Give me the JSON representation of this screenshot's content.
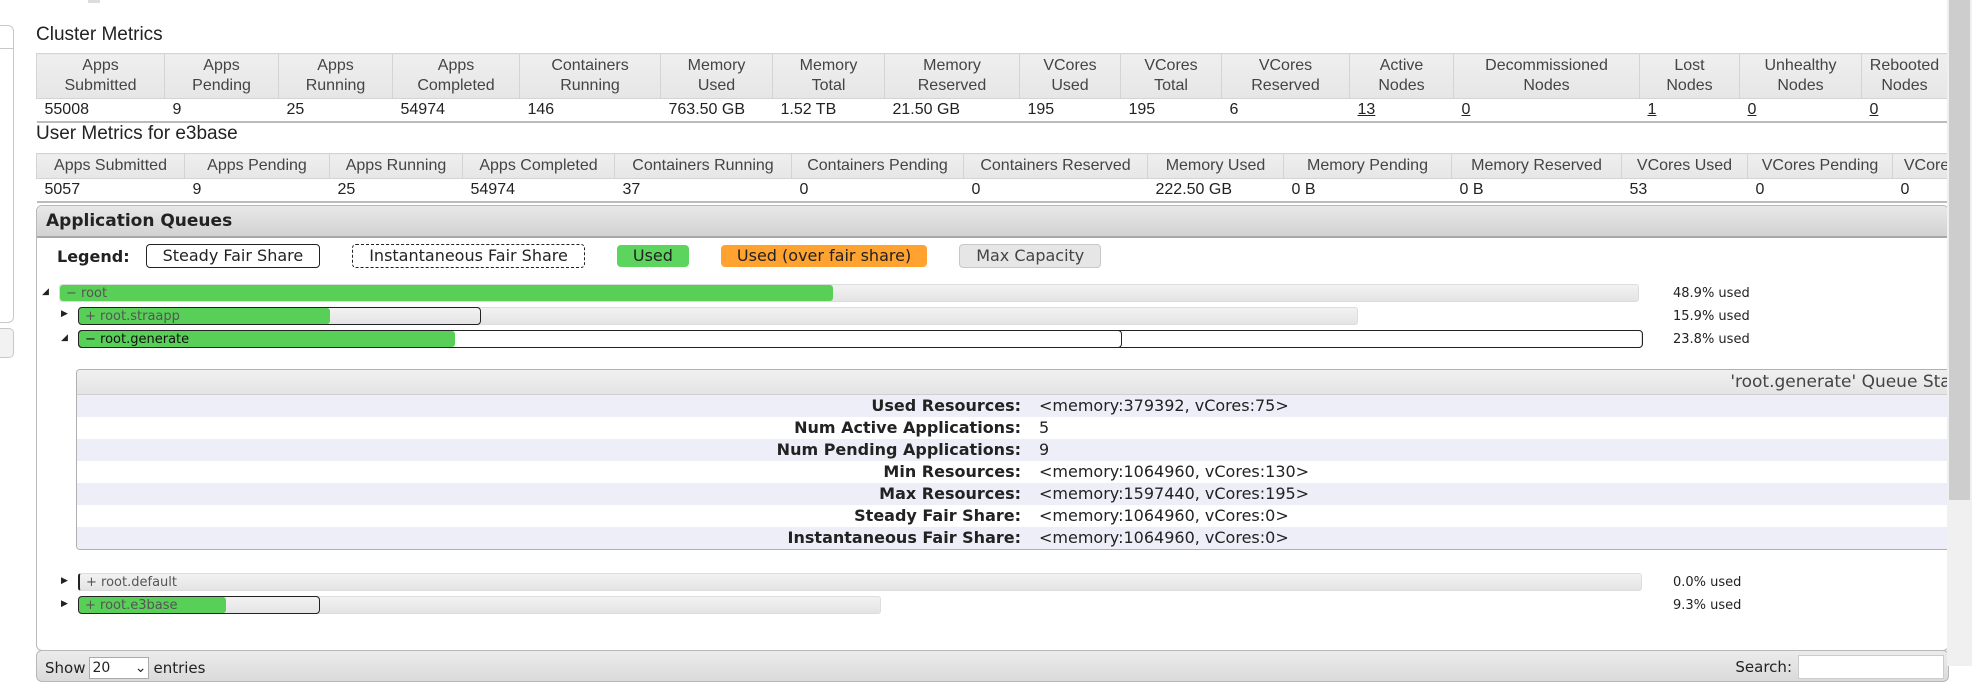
{
  "cluster_metrics": {
    "title": "Cluster Metrics",
    "headers": [
      [
        "Apps",
        "Submitted"
      ],
      [
        "Apps",
        "Pending"
      ],
      [
        "Apps",
        "Running"
      ],
      [
        "Apps",
        "Completed"
      ],
      [
        "Containers",
        "Running"
      ],
      [
        "Memory",
        "Used"
      ],
      [
        "Memory",
        "Total"
      ],
      [
        "Memory",
        "Reserved"
      ],
      [
        "VCores",
        "Used"
      ],
      [
        "VCores",
        "Total"
      ],
      [
        "VCores",
        "Reserved"
      ],
      [
        "Active",
        "Nodes"
      ],
      [
        "Decommissioned",
        "Nodes"
      ],
      [
        "Lost",
        "Nodes"
      ],
      [
        "Unhealthy",
        "Nodes"
      ],
      [
        "Rebooted",
        "Nodes"
      ]
    ],
    "values": [
      "55008",
      "9",
      "25",
      "54974",
      "146",
      "763.50 GB",
      "1.52 TB",
      "21.50 GB",
      "195",
      "195",
      "6",
      "13",
      "0",
      "1",
      "0",
      "0"
    ],
    "linked": [
      false,
      false,
      false,
      false,
      false,
      false,
      false,
      false,
      false,
      false,
      false,
      true,
      true,
      true,
      true,
      true
    ]
  },
  "user_metrics": {
    "title": "User Metrics for e3base",
    "headers": [
      "Apps Submitted",
      "Apps Pending",
      "Apps Running",
      "Apps Completed",
      "Containers Running",
      "Containers Pending",
      "Containers Reserved",
      "Memory Used",
      "Memory Pending",
      "Memory Reserved",
      "VCores Used",
      "VCores Pending",
      "VCores Reserved"
    ],
    "values": [
      "5057",
      "9",
      "25",
      "54974",
      "37",
      "0",
      "0",
      "222.50 GB",
      "0 B",
      "0 B",
      "53",
      "0",
      "0"
    ]
  },
  "queues": {
    "title": "Application Queues",
    "legend": {
      "label": "Legend:",
      "items": [
        "Steady Fair Share",
        "Instantaneous Fair Share",
        "Used",
        "Used (over fair share)",
        "Max Capacity"
      ]
    },
    "colors": {
      "used": "#58d058",
      "over": "#ffa230",
      "max": "#e6e6e6"
    },
    "list": [
      {
        "name": "root",
        "sign": "−",
        "expanded": true,
        "used_pct": "48.9% used",
        "used_fraction": 0.489
      },
      {
        "name": "root.straapp",
        "sign": "+",
        "expanded": false,
        "used_pct": "15.9% used",
        "used_fraction": 0.159
      },
      {
        "name": "root.generate",
        "sign": "−",
        "expanded": true,
        "used_pct": "23.8% used",
        "used_fraction": 0.238
      },
      {
        "name": "root.default",
        "sign": "+",
        "expanded": false,
        "used_pct": "0.0% used",
        "used_fraction": 0.0
      },
      {
        "name": "root.e3base",
        "sign": "+",
        "expanded": false,
        "used_pct": "9.3% used",
        "used_fraction": 0.093
      }
    ],
    "stats": {
      "header": "'root.generate' Queue Status",
      "rows": [
        {
          "k": "Used Resources:",
          "v": "<memory:379392, vCores:75>"
        },
        {
          "k": "Num Active Applications:",
          "v": "5"
        },
        {
          "k": "Num Pending Applications:",
          "v": "9"
        },
        {
          "k": "Min Resources:",
          "v": "<memory:1064960, vCores:130>"
        },
        {
          "k": "Max Resources:",
          "v": "<memory:1597440, vCores:195>"
        },
        {
          "k": "Steady Fair Share:",
          "v": "<memory:1064960, vCores:0>"
        },
        {
          "k": "Instantaneous Fair Share:",
          "v": "<memory:1064960, vCores:0>"
        }
      ]
    }
  },
  "table_controls": {
    "show_label": "Show",
    "entries_value": "20",
    "entries_label": "entries",
    "search_label": "Search:"
  }
}
